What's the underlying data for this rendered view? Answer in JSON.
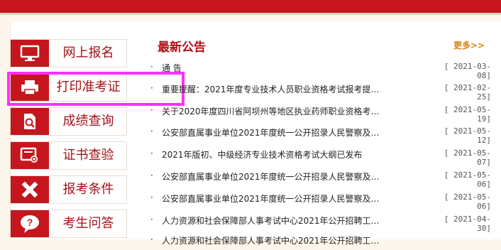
{
  "sidebar": {
    "items": [
      {
        "label": "网上报名",
        "icon": "monitor-icon"
      },
      {
        "label": "打印准考证",
        "icon": "printer-icon"
      },
      {
        "label": "成绩查询",
        "icon": "document-search-icon"
      },
      {
        "label": "证书查验",
        "icon": "certificate-check-icon"
      },
      {
        "label": "报考条件",
        "icon": "pencil-ruler-icon"
      },
      {
        "label": "考生问答",
        "icon": "question-bubble-icon"
      }
    ]
  },
  "notices": {
    "section_title": "最新公告",
    "more_label": "更多>>",
    "bullet": "·",
    "rows": [
      {
        "title": "通 告",
        "date": "[ 2021-03-08]"
      },
      {
        "title": "重要提醒：2021年度专业技术人员职业资格考试报考提…",
        "date": "[ 2021-02-25]"
      },
      {
        "title": "关于2020年度四川省阿坝州等地区执业药师职业资格考…",
        "date": "[ 2021-05-19]"
      },
      {
        "title": "公安部直属事业单位2021年度统一公开招录人民警察及…",
        "date": "[ 2021-05-12]"
      },
      {
        "title": "2021年版初、中级经济专业技术资格考试大纲已发布",
        "date": "[ 2021-05-07]"
      },
      {
        "title": "公安部直属事业单位2021年度统一公开招录人民警察及…",
        "date": "[ 2021-05-06]"
      },
      {
        "title": "公安部直属事业单位2021年度统一公开招录人民警察及…",
        "date": "[ 2021-05-06]"
      },
      {
        "title": "人力资源和社会保障部人事考试中心2021年公开招聘工…",
        "date": "[ 2021-04-30]"
      },
      {
        "title": "人力资源和社会保障部人事考试中心2021年公开招聘工…",
        "date": ""
      }
    ]
  },
  "colors": {
    "brand_red": "#c4161c",
    "highlight": "#ff30ff",
    "more_orange": "#d9820f"
  }
}
